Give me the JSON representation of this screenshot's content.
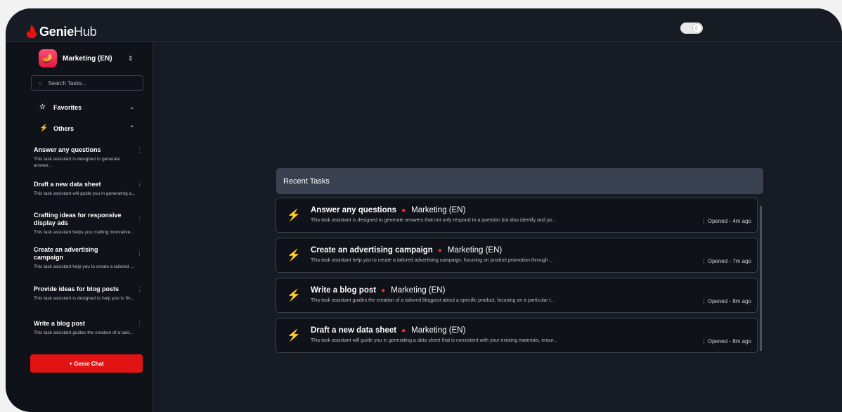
{
  "brand": {
    "bold": "Genie",
    "light": "Hub",
    "color": "#e11313"
  },
  "theme_toggle": {
    "icon": "moon-icon",
    "state": "dark"
  },
  "sidebar": {
    "workspace": {
      "label": "Marketing (EN)",
      "icon": "genie-lamp-icon"
    },
    "search": {
      "placeholder": "Search Tasks..."
    },
    "favorites": {
      "label": "Favorites"
    },
    "others": {
      "label": "Others"
    },
    "tasks": [
      {
        "title": "Answer any questions",
        "desc": "This task assistant is designed to generate answer..."
      },
      {
        "title": "Draft a new data sheet",
        "desc": "This task assistant will guide you in generating a..."
      },
      {
        "title": "Crafting ideas for responsive display ads",
        "desc": "This task assistant helps you crafting innovative..."
      },
      {
        "title": "Create an advertising campaign",
        "desc": "This task assistant help you to create a tailored ..."
      },
      {
        "title": "Provide ideas for blog posts",
        "desc": "This task assistant is designed to help you to fin..."
      },
      {
        "title": "Write a blog post",
        "desc": "This task assistant guides the creation of a tailo..."
      }
    ],
    "genie_chat": "+ Genie Chat"
  },
  "main": {
    "recent_title": "Recent Tasks",
    "recent": [
      {
        "title": "Answer any questions",
        "workspace": "Marketing (EN)",
        "desc": "This task assistant is designed to generate answers that not only respond to a question but also identify and po...",
        "opened": "Opened - 4m ago"
      },
      {
        "title": "Create an advertising campaign",
        "workspace": "Marketing (EN)",
        "desc": "This task assistant help you to create a tailored advertising campaign, focusing on product promotion through ...",
        "opened": "Opened - 7m ago"
      },
      {
        "title": "Write a blog post",
        "workspace": "Marketing (EN)",
        "desc": "This task assistant guides the creation of a tailored blogpost about a specific product, focusing on a particular t...",
        "opened": "Opened - 8m ago"
      },
      {
        "title": "Draft a new data sheet",
        "workspace": "Marketing (EN)",
        "desc": "This task assistant will guide you in generating a data sheet that is consistent with your existing materials, ensur...",
        "opened": "Opened - 8m ago"
      }
    ]
  }
}
